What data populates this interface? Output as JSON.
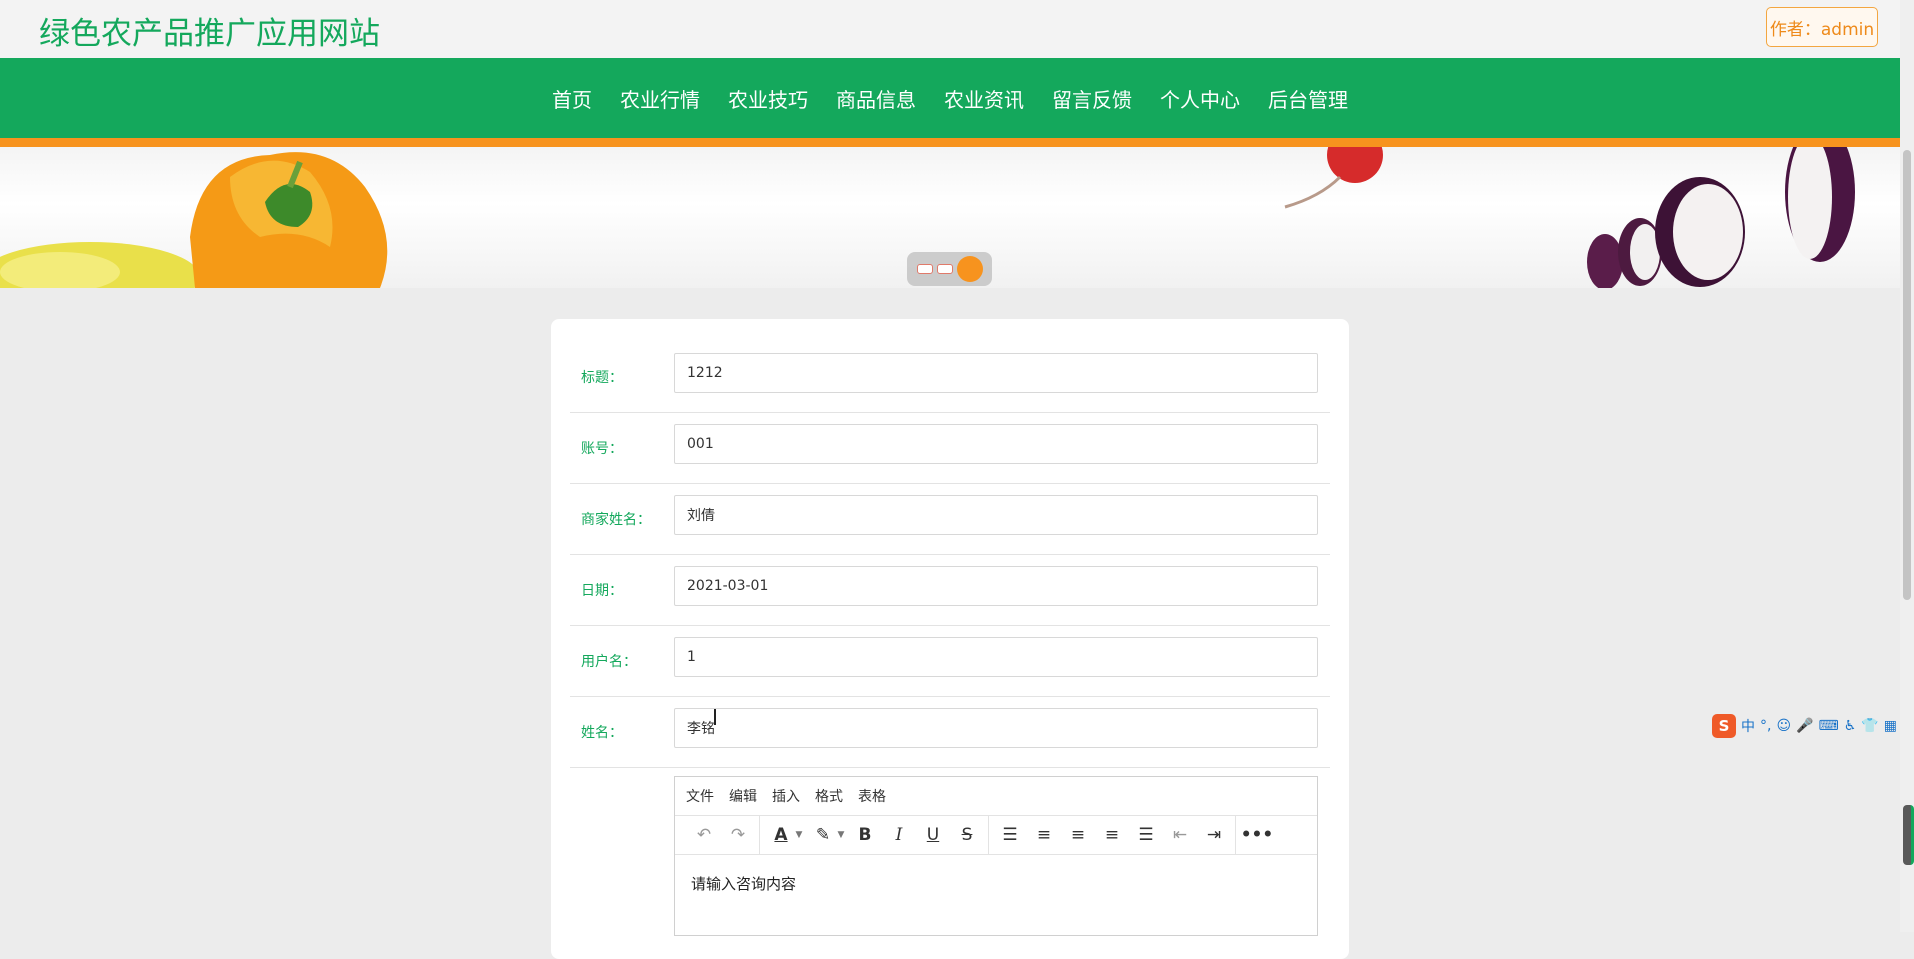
{
  "header": {
    "site_title": "绿色农产品推广应用网站",
    "author_badge": "作者：admin"
  },
  "nav": {
    "items": [
      "首页",
      "农业行情",
      "农业技巧",
      "商品信息",
      "农业资讯",
      "留言反馈",
      "个人中心",
      "后台管理"
    ]
  },
  "banner": {
    "slides_total": 3,
    "active_slide": 3
  },
  "form": {
    "fields": [
      {
        "label": "标题：",
        "value": "1212"
      },
      {
        "label": "账号：",
        "value": "001"
      },
      {
        "label": "商家姓名：",
        "value": "刘倩"
      },
      {
        "label": "日期：",
        "value": "2021-03-01"
      },
      {
        "label": "用户名：",
        "value": "1"
      },
      {
        "label": "姓名：",
        "value": "李铭"
      }
    ],
    "editor": {
      "menu": [
        "文件",
        "编辑",
        "插入",
        "格式",
        "表格"
      ],
      "content": "请输入咨询内容"
    }
  },
  "ime": {
    "logo": "S",
    "items": [
      "中",
      "°,",
      "☺",
      "🎤",
      "⌨",
      "♿",
      "👕",
      "▦"
    ]
  },
  "colors": {
    "brand_green": "#14a85c",
    "accent_orange": "#f7931e"
  }
}
